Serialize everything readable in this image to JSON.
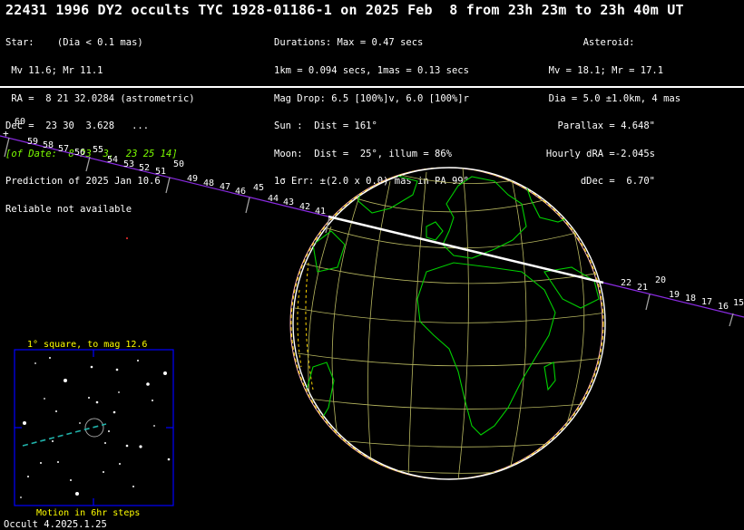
{
  "title": "22431 1996 DY2 occults TYC 1928-01186-1 on 2025 Feb  8 from 23h 23m to 23h 40m UT",
  "star_block": [
    "Star:    (Dia < 0.1 mas)",
    " Mv 11.6; Mr 11.1",
    " RA =  8 21 32.0284 (astrometric)",
    "Dec =  23 30  3.628   ...",
    "[of Date:  8 23  3,  23 25 14]",
    "Prediction of 2025 Jan 10.6",
    "Reliable not available"
  ],
  "event_block": [
    "Durations: Max = 0.47 secs",
    "1km = 0.094 secs, 1mas = 0.13 secs",
    "Mag Drop: 6.5 [100%]v, 6.0 [100%]r",
    "Sun :  Dist = 161°",
    "Moon:  Dist =  25°, illum = 86%",
    "1σ Err: ±(2.0 x 0.0) mas in PA 99°"
  ],
  "asteroid_block": [
    "        Asteroid:",
    "  Mv = 18.1; Mr = 17.1",
    "  Dia = 5.0 ±1.0km, 4 mas",
    "  Parallax = 4.648\"",
    "Hourly dRA =-2.045s",
    "    dDec =  6.70\""
  ],
  "path_tick_labels": [
    "60",
    "59",
    "58",
    "57",
    "56",
    "55",
    "54",
    "53",
    "52",
    "51",
    "50",
    "49",
    "48",
    "47",
    "46",
    "45",
    "44",
    "43",
    "42",
    "41",
    "22",
    "21",
    "20",
    "19",
    "18",
    "17",
    "16",
    "15"
  ],
  "starchart": {
    "title": "1° square, to mag 12.6",
    "caption": "Motion in 6hr steps"
  },
  "footer": "Occult 4.2025.1.25",
  "colors": {
    "background": "#000000",
    "text": "#ffffff",
    "grid": "#b8b860",
    "coast": "#00d000",
    "path": "#8a2be2",
    "chart_title": "#ffff00",
    "chart_frame": "#0000ff",
    "motion": "#20b2aa"
  }
}
